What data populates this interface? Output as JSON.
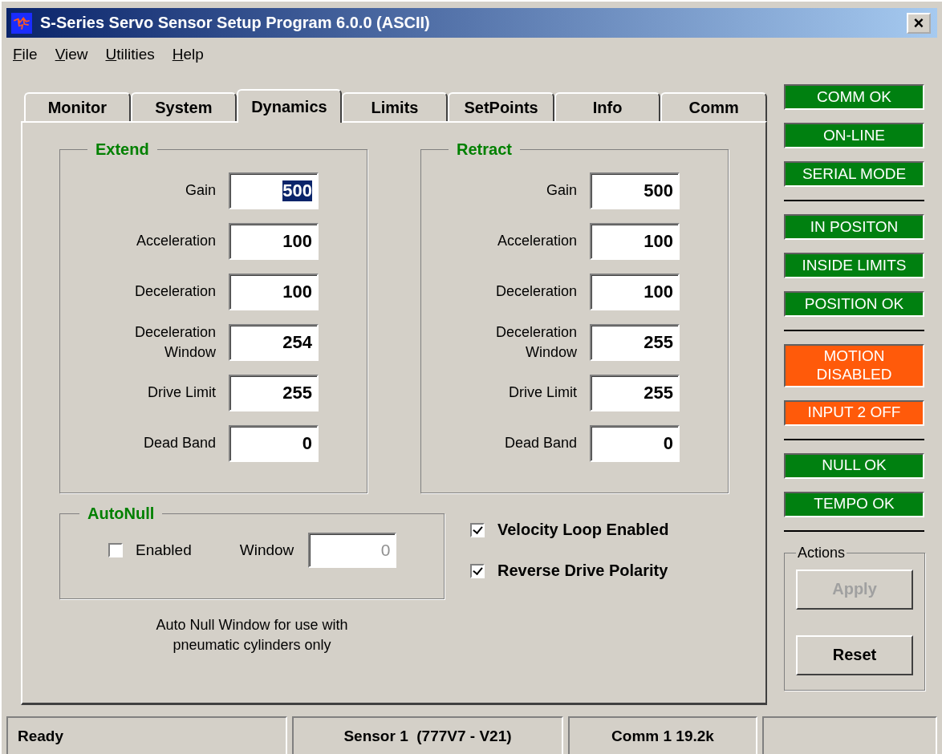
{
  "window": {
    "title": "S-Series Servo Sensor Setup Program 6.0.0 (ASCII)",
    "close": "×"
  },
  "menu": [
    {
      "label": "File"
    },
    {
      "label": "View"
    },
    {
      "label": "Utilities"
    },
    {
      "label": "Help"
    }
  ],
  "tabs": [
    {
      "label": "Monitor",
      "selected": false
    },
    {
      "label": "System",
      "selected": false
    },
    {
      "label": "Dynamics",
      "selected": true
    },
    {
      "label": "Limits",
      "selected": false
    },
    {
      "label": "SetPoints",
      "selected": false
    },
    {
      "label": "Info",
      "selected": false
    },
    {
      "label": "Comm",
      "selected": false
    }
  ],
  "groups": [
    {
      "title": "Extend",
      "fields": [
        {
          "label": "Gain",
          "value": "500",
          "selected": true
        },
        {
          "label": "Acceleration",
          "value": "100",
          "selected": false
        },
        {
          "label": "Deceleration",
          "value": "100",
          "selected": false
        },
        {
          "label": "Deceleration Window",
          "value": "254",
          "selected": false
        },
        {
          "label": "Drive Limit",
          "value": "255",
          "selected": false
        },
        {
          "label": "Dead Band",
          "value": "0",
          "selected": false
        }
      ]
    },
    {
      "title": "Retract",
      "fields": [
        {
          "label": "Gain",
          "value": "500",
          "selected": false
        },
        {
          "label": "Acceleration",
          "value": "100",
          "selected": false
        },
        {
          "label": "Deceleration",
          "value": "100",
          "selected": false
        },
        {
          "label": "Deceleration Window",
          "value": "255",
          "selected": false
        },
        {
          "label": "Drive Limit",
          "value": "255",
          "selected": false
        },
        {
          "label": "Dead Band",
          "value": "0",
          "selected": false
        }
      ]
    }
  ],
  "autonull": {
    "title": "AutoNull",
    "enabled": {
      "label": "Enabled",
      "checked": false
    },
    "window": {
      "label": "Window",
      "value": "0",
      "disabled": true
    },
    "note": "Auto Null Window for use with pneumatic cylinders only"
  },
  "options": [
    {
      "label": "Velocity Loop Enabled",
      "checked": true
    },
    {
      "label": "Reverse Drive Polarity",
      "checked": true
    }
  ],
  "indicator_groups": [
    [
      {
        "label": "COMM OK",
        "color": "#008010"
      },
      {
        "label": "ON-LINE",
        "color": "#008010"
      },
      {
        "label": "SERIAL MODE",
        "color": "#008010"
      }
    ],
    [
      {
        "label": "IN POSITON",
        "color": "#008010"
      },
      {
        "label": "INSIDE LIMITS",
        "color": "#008010"
      },
      {
        "label": "POSITION OK",
        "color": "#008010"
      }
    ],
    [
      {
        "label": "MOTION DISABLED",
        "color": "#ff5a0a"
      },
      {
        "label": "INPUT 2 OFF",
        "color": "#ff5a0a"
      }
    ],
    [
      {
        "label": "NULL OK",
        "color": "#008010"
      },
      {
        "label": "TEMPO OK",
        "color": "#008010"
      }
    ]
  ],
  "actions": {
    "title": "Actions",
    "buttons": [
      {
        "label": "Apply",
        "disabled": true
      },
      {
        "label": "Reset",
        "disabled": false
      }
    ]
  },
  "status_bar": [
    "Ready",
    "Sensor 1  (777V7 - V21)",
    "Comm 1 19.2k"
  ]
}
